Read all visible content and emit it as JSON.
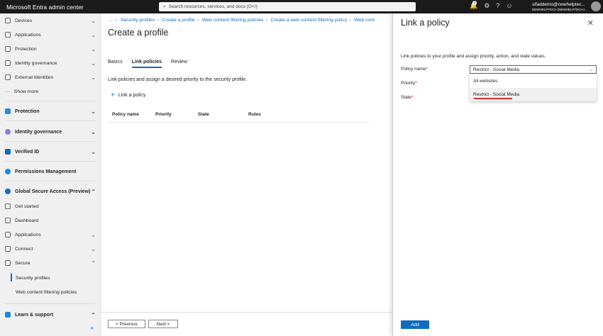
{
  "topbar": {
    "title": "Microsoft Entra admin center",
    "search_placeholder": "Search resources, services, and docs (G+/)",
    "notification_count": "1",
    "user_email": "sifaddemo@newhelptec...",
    "user_tenant": "NEWHELPTECH (NEWHELPTECH.I..."
  },
  "sidebar": {
    "items": [
      {
        "label": "Devices"
      },
      {
        "label": "Applications"
      },
      {
        "label": "Protection"
      },
      {
        "label": "Identity governance"
      },
      {
        "label": "External Identities"
      },
      {
        "label": "Show more"
      },
      {
        "label": "Protection"
      },
      {
        "label": "Identity governance"
      },
      {
        "label": "Verified ID"
      },
      {
        "label": "Permissions Management"
      },
      {
        "label": "Global Secure Access (Preview)"
      },
      {
        "label": "Get started"
      },
      {
        "label": "Dashboard"
      },
      {
        "label": "Applications"
      },
      {
        "label": "Connect"
      },
      {
        "label": "Secure"
      },
      {
        "label": "Security profiles"
      },
      {
        "label": "Web content filtering policies"
      },
      {
        "label": "Learn & support"
      }
    ],
    "collapse": "«"
  },
  "main": {
    "breadcrumb": [
      "...",
      "Security profiles",
      "Create a profile",
      "Web content filtering policies",
      "Create a web content filtering policy",
      "Web cont"
    ],
    "title": "Create a profile",
    "more": "···",
    "tabs": [
      "Basics",
      "Link policies",
      "Review"
    ],
    "description": "Link policies and assign a desired priority to the security profile.",
    "link_policy": "Link a policy",
    "columns": [
      "Policy name",
      "Priority",
      "State",
      "Rules"
    ],
    "previous": "< Previous",
    "next": "Next >"
  },
  "panel": {
    "title": "Link a policy",
    "description": "Link policies to your profile and assign priority, action, and state values.",
    "policy_label": "Policy name",
    "priority_label": "Priority",
    "state_label": "State",
    "required": "*",
    "policy_value": "Restrict - Social Media",
    "options": [
      "All websites",
      "Restrict - Social Media"
    ],
    "add": "Add"
  },
  "colors": {
    "accent": "#0f6cbd",
    "topbar": "#1b1b1b",
    "underline": "#d13438"
  }
}
